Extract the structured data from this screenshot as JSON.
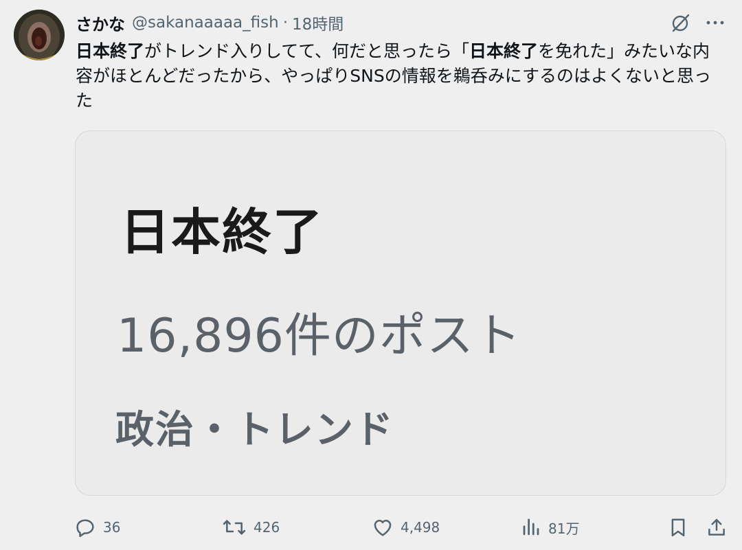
{
  "post": {
    "display_name": "さかな",
    "handle": "@sakanaaaaa_fish",
    "separator": "·",
    "timestamp": "18時間",
    "text": {
      "segments": [
        {
          "t": "日本終了",
          "b": true
        },
        {
          "t": "がトレンド入りしてて、何だと思ったら「",
          "b": false
        },
        {
          "t": "日本終了",
          "b": true
        },
        {
          "t": "を免れた」みたいな内容がほとんどだったから、やっぱりSNSの情報を鵜呑みにするのはよくないと思った",
          "b": false
        }
      ]
    }
  },
  "card": {
    "title": "日本終了",
    "count": "16,896件のポスト",
    "category": "政治・トレンド"
  },
  "actions": {
    "replies": "36",
    "reposts": "426",
    "likes": "4,498",
    "views": "81万"
  },
  "icons": {
    "grok": "grok-icon",
    "more": "more-icon",
    "reply": "reply-icon",
    "repost": "repost-icon",
    "like": "heart-icon",
    "views": "views-icon",
    "bookmark": "bookmark-icon",
    "share": "share-icon"
  },
  "colors": {
    "background": "#efefef",
    "primary_text": "#0f1419",
    "secondary_text": "#536471",
    "card_border": "#cfd9de"
  }
}
